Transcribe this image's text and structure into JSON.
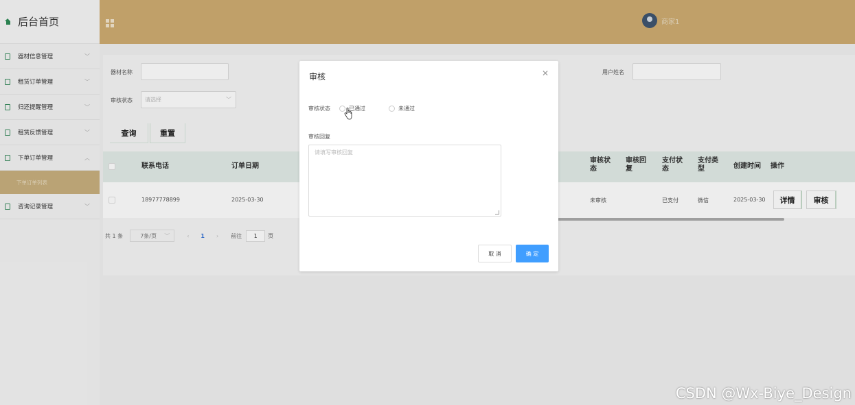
{
  "sidebar": {
    "home_label": "后台首页",
    "items": [
      {
        "label": "器材信息管理"
      },
      {
        "label": "租赁订单管理"
      },
      {
        "label": "归还提醒管理"
      },
      {
        "label": "租赁反馈管理"
      },
      {
        "label": "下单订单管理"
      },
      {
        "label": "咨询记录管理"
      }
    ],
    "active_sub": "下单订单列表"
  },
  "header": {
    "username": "商家1"
  },
  "filters": {
    "equipment_name_label": "器材名称",
    "user_name_label": "用户姓名",
    "audit_status_label": "审核状态",
    "audit_status_placeholder": "请选择",
    "search_button": "查询",
    "reset_button": "重置"
  },
  "table": {
    "columns": [
      "联系电话",
      "订单日期",
      "审核状态",
      "审核回复",
      "支付状态",
      "支付类型",
      "创建时间",
      "操作"
    ],
    "column_lines": {
      "audit_status": [
        "审核状",
        "态"
      ],
      "audit_reply": [
        "审核回",
        "复"
      ],
      "pay_status": [
        "支付状",
        "态"
      ],
      "pay_type": [
        "支付类",
        "型"
      ]
    },
    "rows": [
      {
        "phone": "18977778899",
        "order_date": "2025-03-30",
        "audit_status": "未审核",
        "audit_reply": "",
        "pay_status": "已支付",
        "pay_type": "微信",
        "created_at": "2025-03-30",
        "detail_button": "详情",
        "audit_button": "审核"
      }
    ]
  },
  "pagination": {
    "total": "共 1 条",
    "page_size": "7条/页",
    "current_page": "1",
    "goto_label": "前往",
    "goto_value": "1",
    "page_suffix": "页"
  },
  "dialog": {
    "title": "审核",
    "status_label": "审核状态",
    "options": [
      "已通过",
      "未通过"
    ],
    "reply_label": "审核回复",
    "reply_placeholder": "请填写审核回复",
    "cancel": "取 消",
    "confirm": "确 定"
  },
  "watermark": "CSDN @Wx-Biye_Design",
  "colors": {
    "header": "#cfad72",
    "active_sub": "#c9b07e",
    "confirm_button": "#409eff",
    "table_header": "#e2ece8"
  }
}
